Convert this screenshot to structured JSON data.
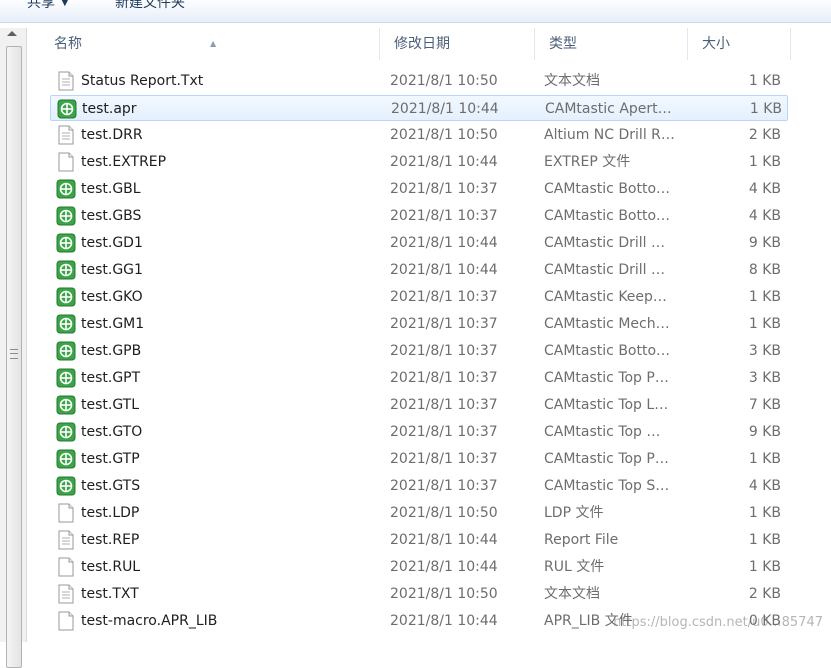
{
  "toolbar": {
    "share_label": "共享",
    "new_folder_label": "新建文件夹"
  },
  "columns": {
    "name": "名称",
    "date": "修改日期",
    "type": "类型",
    "size": "大小"
  },
  "files": [
    {
      "name": "Status Report.Txt",
      "date": "2021/8/1 10:50",
      "type": "文本文档",
      "size": "1 KB",
      "icon": "text-document-icon"
    },
    {
      "name": "test.apr",
      "date": "2021/8/1 10:44",
      "type": "CAMtastic Apert…",
      "size": "1 KB",
      "icon": "camtastic-file-icon",
      "selected": true
    },
    {
      "name": "test.DRR",
      "date": "2021/8/1 10:50",
      "type": "Altium NC Drill R…",
      "size": "2 KB",
      "icon": "text-document-icon"
    },
    {
      "name": "test.EXTREP",
      "date": "2021/8/1 10:44",
      "type": "EXTREP 文件",
      "size": "1 KB",
      "icon": "blank-file-icon"
    },
    {
      "name": "test.GBL",
      "date": "2021/8/1 10:37",
      "type": "CAMtastic Botto…",
      "size": "4 KB",
      "icon": "camtastic-file-icon"
    },
    {
      "name": "test.GBS",
      "date": "2021/8/1 10:37",
      "type": "CAMtastic Botto…",
      "size": "4 KB",
      "icon": "camtastic-file-icon"
    },
    {
      "name": "test.GD1",
      "date": "2021/8/1 10:44",
      "type": "CAMtastic Drill …",
      "size": "9 KB",
      "icon": "camtastic-file-icon"
    },
    {
      "name": "test.GG1",
      "date": "2021/8/1 10:44",
      "type": "CAMtastic Drill …",
      "size": "8 KB",
      "icon": "camtastic-file-icon"
    },
    {
      "name": "test.GKO",
      "date": "2021/8/1 10:37",
      "type": "CAMtastic Keep…",
      "size": "1 KB",
      "icon": "camtastic-file-icon"
    },
    {
      "name": "test.GM1",
      "date": "2021/8/1 10:37",
      "type": "CAMtastic Mech…",
      "size": "1 KB",
      "icon": "camtastic-file-icon"
    },
    {
      "name": "test.GPB",
      "date": "2021/8/1 10:37",
      "type": "CAMtastic Botto…",
      "size": "3 KB",
      "icon": "camtastic-file-icon"
    },
    {
      "name": "test.GPT",
      "date": "2021/8/1 10:37",
      "type": "CAMtastic Top P…",
      "size": "3 KB",
      "icon": "camtastic-file-icon"
    },
    {
      "name": "test.GTL",
      "date": "2021/8/1 10:37",
      "type": "CAMtastic Top L…",
      "size": "7 KB",
      "icon": "camtastic-file-icon"
    },
    {
      "name": "test.GTO",
      "date": "2021/8/1 10:37",
      "type": "CAMtastic Top …",
      "size": "9 KB",
      "icon": "camtastic-file-icon"
    },
    {
      "name": "test.GTP",
      "date": "2021/8/1 10:37",
      "type": "CAMtastic Top P…",
      "size": "1 KB",
      "icon": "camtastic-file-icon"
    },
    {
      "name": "test.GTS",
      "date": "2021/8/1 10:37",
      "type": "CAMtastic Top S…",
      "size": "4 KB",
      "icon": "camtastic-file-icon"
    },
    {
      "name": "test.LDP",
      "date": "2021/8/1 10:50",
      "type": "LDP 文件",
      "size": "1 KB",
      "icon": "blank-file-icon"
    },
    {
      "name": "test.REP",
      "date": "2021/8/1 10:44",
      "type": "Report File",
      "size": "1 KB",
      "icon": "text-document-icon"
    },
    {
      "name": "test.RUL",
      "date": "2021/8/1 10:44",
      "type": "RUL 文件",
      "size": "1 KB",
      "icon": "blank-file-icon"
    },
    {
      "name": "test.TXT",
      "date": "2021/8/1 10:50",
      "type": "文本文档",
      "size": "2 KB",
      "icon": "text-document-icon"
    },
    {
      "name": "test-macro.APR_LIB",
      "date": "2021/8/1 10:44",
      "type": "APR_LIB 文件",
      "size": "0 KB",
      "icon": "blank-file-icon"
    }
  ],
  "watermark": "https://blog.csdn.net/u0…85747",
  "colors": {
    "camtastic_icon": "#3aa447",
    "selection_border": "#b8d6fb",
    "header_text": "#4c607a"
  }
}
